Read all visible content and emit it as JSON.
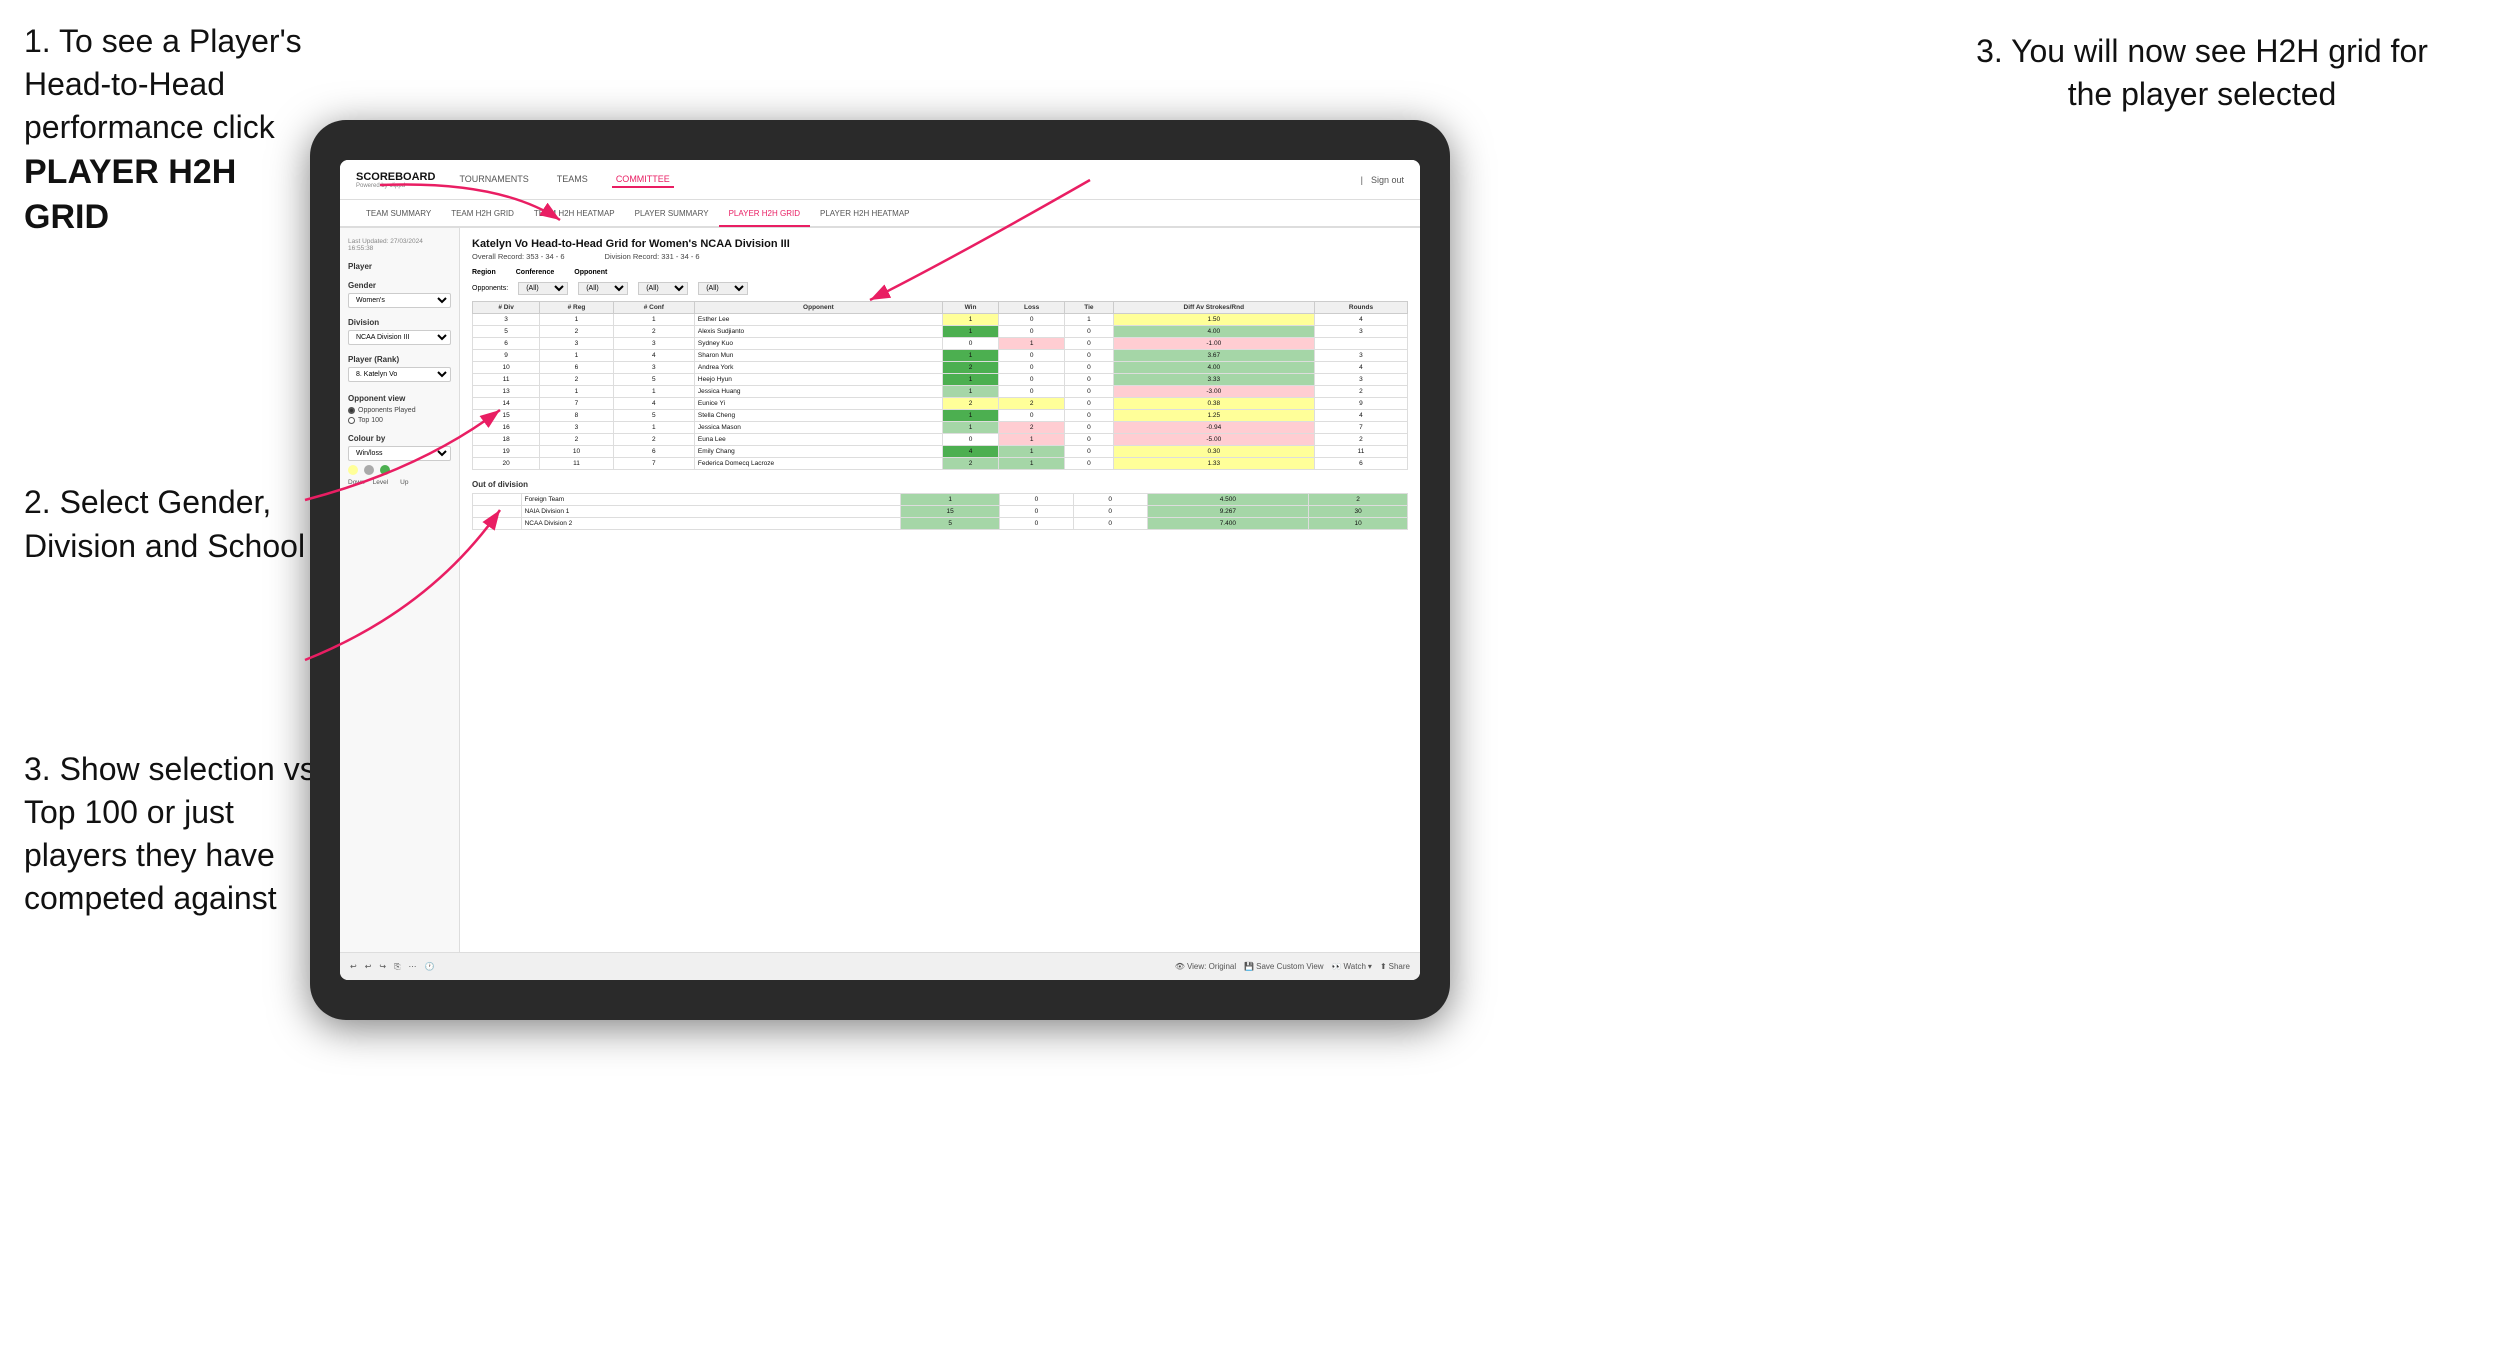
{
  "instructions": {
    "step1_text": "1. To see a Player's Head-to-Head performance click",
    "step1_bold": "PLAYER H2H GRID",
    "step2_text": "2. Select Gender, Division and School",
    "step3_left_text": "3. Show selection vs Top 100 or just players they have competed against",
    "step3_right_text": "3. You will now see H2H grid for the player selected"
  },
  "nav": {
    "logo": "SCOREBOARD",
    "powered": "Powered by clippd",
    "items": [
      "TOURNAMENTS",
      "TEAMS",
      "COMMITTEE"
    ],
    "sign_out": "Sign out"
  },
  "sub_nav": {
    "items": [
      "TEAM SUMMARY",
      "TEAM H2H GRID",
      "TEAM H2H HEATMAP",
      "PLAYER SUMMARY",
      "PLAYER H2H GRID",
      "PLAYER H2H HEATMAP"
    ]
  },
  "sidebar": {
    "timestamp": "Last Updated: 27/03/2024\n16:55:38",
    "player_label": "Player",
    "gender_label": "Gender",
    "gender_value": "Women's",
    "division_label": "Division",
    "division_value": "NCAA Division III",
    "player_rank_label": "Player (Rank)",
    "player_rank_value": "8. Katelyn Vo",
    "opponent_view_label": "Opponent view",
    "opponent_options": [
      "Opponents Played",
      "Top 100"
    ],
    "opponent_selected": "Opponents Played",
    "colour_by_label": "Colour by",
    "colour_by_value": "Win/loss",
    "legend": {
      "down": "Down",
      "level": "Level",
      "up": "Up"
    }
  },
  "main": {
    "title": "Katelyn Vo Head-to-Head Grid for Women's NCAA Division III",
    "overall_record": "Overall Record: 353 - 34 - 6",
    "division_record": "Division Record: 331 - 34 - 6",
    "filters": {
      "opponents_label": "Opponents:",
      "opponents_value": "(All)",
      "region_label": "Region",
      "conference_label": "Conference",
      "conference_value": "(All)",
      "opponent_label": "Opponent",
      "opponent_value": "(All)"
    },
    "table_headers": [
      "# Div",
      "# Reg",
      "# Conf",
      "Opponent",
      "Win",
      "Loss",
      "Tie",
      "Diff Av Strokes/Rnd",
      "Rounds"
    ],
    "rows": [
      {
        "div": "3",
        "reg": "1",
        "conf": "1",
        "opponent": "Esther Lee",
        "win": 1,
        "loss": 0,
        "tie": 1,
        "diff": "1.50",
        "rounds": 4,
        "win_color": "yellow",
        "loss_color": "white",
        "tie_color": "white"
      },
      {
        "div": "5",
        "reg": "2",
        "conf": "2",
        "opponent": "Alexis Sudjianto",
        "win": 1,
        "loss": 0,
        "tie": 0,
        "diff": "4.00",
        "rounds": 3,
        "win_color": "green",
        "loss_color": "white",
        "tie_color": "white"
      },
      {
        "div": "6",
        "reg": "3",
        "conf": "3",
        "opponent": "Sydney Kuo",
        "win": 0,
        "loss": 1,
        "tie": 0,
        "diff": "-1.00",
        "rounds": "",
        "win_color": "white",
        "loss_color": "red",
        "tie_color": "white"
      },
      {
        "div": "9",
        "reg": "1",
        "conf": "4",
        "opponent": "Sharon Mun",
        "win": 1,
        "loss": 0,
        "tie": 0,
        "diff": "3.67",
        "rounds": 3,
        "win_color": "green",
        "loss_color": "white",
        "tie_color": "white"
      },
      {
        "div": "10",
        "reg": "6",
        "conf": "3",
        "opponent": "Andrea York",
        "win": 2,
        "loss": 0,
        "tie": 0,
        "diff": "4.00",
        "rounds": 4,
        "win_color": "green",
        "loss_color": "white",
        "tie_color": "white"
      },
      {
        "div": "11",
        "reg": "2",
        "conf": "5",
        "opponent": "Heejo Hyun",
        "win": 1,
        "loss": 0,
        "tie": 0,
        "diff": "3.33",
        "rounds": 3,
        "win_color": "green",
        "loss_color": "white",
        "tie_color": "white"
      },
      {
        "div": "13",
        "reg": "1",
        "conf": "1",
        "opponent": "Jessica Huang",
        "win": 1,
        "loss": 0,
        "tie": 0,
        "diff": "-3.00",
        "rounds": 2,
        "win_color": "light-green",
        "loss_color": "white",
        "tie_color": "white"
      },
      {
        "div": "14",
        "reg": "7",
        "conf": "4",
        "opponent": "Eunice Yi",
        "win": 2,
        "loss": 2,
        "tie": 0,
        "diff": "0.38",
        "rounds": 9,
        "win_color": "yellow",
        "loss_color": "yellow",
        "tie_color": "white"
      },
      {
        "div": "15",
        "reg": "8",
        "conf": "5",
        "opponent": "Stella Cheng",
        "win": 1,
        "loss": 0,
        "tie": 0,
        "diff": "1.25",
        "rounds": 4,
        "win_color": "green",
        "loss_color": "white",
        "tie_color": "white"
      },
      {
        "div": "16",
        "reg": "3",
        "conf": "1",
        "opponent": "Jessica Mason",
        "win": 1,
        "loss": 2,
        "tie": 0,
        "diff": "-0.94",
        "rounds": 7,
        "win_color": "light-green",
        "loss_color": "red",
        "tie_color": "white"
      },
      {
        "div": "18",
        "reg": "2",
        "conf": "2",
        "opponent": "Euna Lee",
        "win": 0,
        "loss": 1,
        "tie": 0,
        "diff": "-5.00",
        "rounds": 2,
        "win_color": "white",
        "loss_color": "red",
        "tie_color": "white"
      },
      {
        "div": "19",
        "reg": "10",
        "conf": "6",
        "opponent": "Emily Chang",
        "win": 4,
        "loss": 1,
        "tie": 0,
        "diff": "0.30",
        "rounds": 11,
        "win_color": "green",
        "loss_color": "light-green",
        "tie_color": "white"
      },
      {
        "div": "20",
        "reg": "11",
        "conf": "7",
        "opponent": "Federica Domecq Lacroze",
        "win": 2,
        "loss": 1,
        "tie": 0,
        "diff": "1.33",
        "rounds": 6,
        "win_color": "light-green",
        "loss_color": "light-green",
        "tie_color": "white"
      }
    ],
    "out_of_division_label": "Out of division",
    "out_of_division_rows": [
      {
        "opponent": "Foreign Team",
        "win": 1,
        "loss": 0,
        "tie": 0,
        "diff": "4.500",
        "rounds": 2
      },
      {
        "opponent": "NAIA Division 1",
        "win": 15,
        "loss": 0,
        "tie": 0,
        "diff": "9.267",
        "rounds": 30
      },
      {
        "opponent": "NCAA Division 2",
        "win": 5,
        "loss": 0,
        "tie": 0,
        "diff": "7.400",
        "rounds": 10
      }
    ]
  },
  "toolbar": {
    "view_original": "View: Original",
    "save_custom": "Save Custom View",
    "watch": "Watch",
    "share": "Share"
  }
}
